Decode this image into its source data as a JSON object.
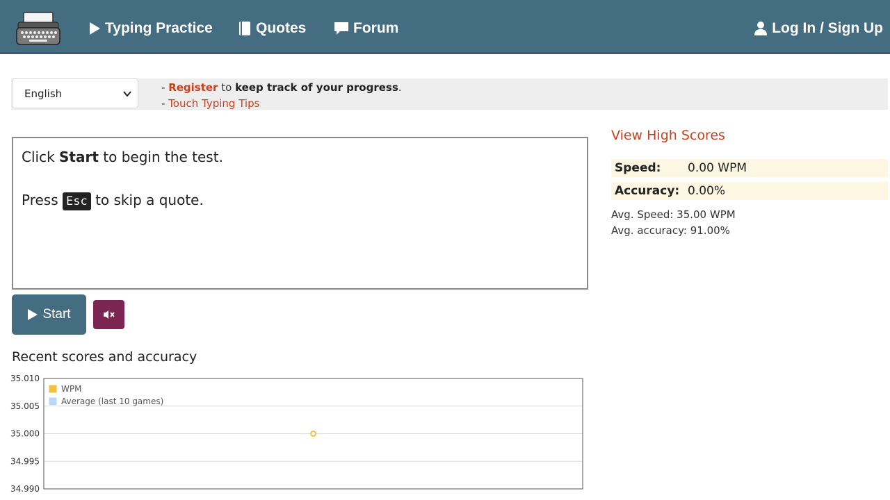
{
  "nav": {
    "typing_practice": "Typing Practice",
    "quotes": "Quotes",
    "forum": "Forum",
    "login": "Log In / Sign Up"
  },
  "info": {
    "language": "English",
    "line1_prefix": "- ",
    "register": "Register",
    "line1_to": " to ",
    "line1_bold": "keep track of your progress",
    "line1_end": ".",
    "line2_prefix": "- ",
    "touch_tips": "Touch Typing Tips"
  },
  "typing_box": {
    "l1_a": "Click ",
    "l1_b": "Start",
    "l1_c": " to begin the test.",
    "l2_a": "Press ",
    "l2_key": "Esc",
    "l2_c": " to skip a quote."
  },
  "controls": {
    "start": "Start"
  },
  "stats": {
    "view_high_scores": "View High Scores",
    "speed_label": "Speed:",
    "speed_value": "0.00 WPM",
    "accuracy_label": "Accuracy:",
    "accuracy_value": "0.00%",
    "avg_speed": "Avg. Speed: 35.00 WPM",
    "avg_accuracy": "Avg. accuracy: 91.00%"
  },
  "recent_title": "Recent scores and accuracy",
  "colors": {
    "navbar": "#456d82",
    "accent_link": "#c9401f",
    "mute_button": "#7a2552",
    "wpm_series": "#f0c040",
    "avg_series": "#b8d8f5"
  },
  "chart_data": {
    "type": "line",
    "title": "Recent scores and accuracy",
    "y_ticks": [
      "35.010",
      "35.005",
      "35.000",
      "34.995",
      "34.990"
    ],
    "ylim": [
      34.99,
      35.01
    ],
    "grid": true,
    "legend_position": "top-left",
    "series": [
      {
        "name": "WPM",
        "color": "#f0c040",
        "x": [
          1
        ],
        "values": [
          35.0
        ]
      },
      {
        "name": "Average (last 10 games)",
        "color": "#b8d8f5",
        "x": [],
        "values": []
      }
    ]
  }
}
